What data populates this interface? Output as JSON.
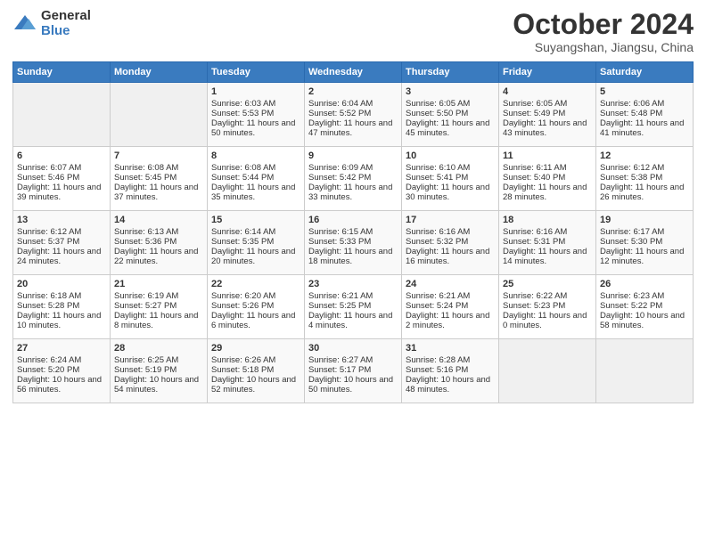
{
  "header": {
    "logo_general": "General",
    "logo_blue": "Blue",
    "month": "October 2024",
    "location": "Suyangshan, Jiangsu, China"
  },
  "weekdays": [
    "Sunday",
    "Monday",
    "Tuesday",
    "Wednesday",
    "Thursday",
    "Friday",
    "Saturday"
  ],
  "weeks": [
    [
      {
        "day": "",
        "empty": true
      },
      {
        "day": "",
        "empty": true
      },
      {
        "day": "1",
        "sunrise": "6:03 AM",
        "sunset": "5:53 PM",
        "daylight": "11 hours and 50 minutes."
      },
      {
        "day": "2",
        "sunrise": "6:04 AM",
        "sunset": "5:52 PM",
        "daylight": "11 hours and 47 minutes."
      },
      {
        "day": "3",
        "sunrise": "6:05 AM",
        "sunset": "5:50 PM",
        "daylight": "11 hours and 45 minutes."
      },
      {
        "day": "4",
        "sunrise": "6:05 AM",
        "sunset": "5:49 PM",
        "daylight": "11 hours and 43 minutes."
      },
      {
        "day": "5",
        "sunrise": "6:06 AM",
        "sunset": "5:48 PM",
        "daylight": "11 hours and 41 minutes."
      }
    ],
    [
      {
        "day": "6",
        "sunrise": "6:07 AM",
        "sunset": "5:46 PM",
        "daylight": "11 hours and 39 minutes."
      },
      {
        "day": "7",
        "sunrise": "6:08 AM",
        "sunset": "5:45 PM",
        "daylight": "11 hours and 37 minutes."
      },
      {
        "day": "8",
        "sunrise": "6:08 AM",
        "sunset": "5:44 PM",
        "daylight": "11 hours and 35 minutes."
      },
      {
        "day": "9",
        "sunrise": "6:09 AM",
        "sunset": "5:42 PM",
        "daylight": "11 hours and 33 minutes."
      },
      {
        "day": "10",
        "sunrise": "6:10 AM",
        "sunset": "5:41 PM",
        "daylight": "11 hours and 30 minutes."
      },
      {
        "day": "11",
        "sunrise": "6:11 AM",
        "sunset": "5:40 PM",
        "daylight": "11 hours and 28 minutes."
      },
      {
        "day": "12",
        "sunrise": "6:12 AM",
        "sunset": "5:38 PM",
        "daylight": "11 hours and 26 minutes."
      }
    ],
    [
      {
        "day": "13",
        "sunrise": "6:12 AM",
        "sunset": "5:37 PM",
        "daylight": "11 hours and 24 minutes."
      },
      {
        "day": "14",
        "sunrise": "6:13 AM",
        "sunset": "5:36 PM",
        "daylight": "11 hours and 22 minutes."
      },
      {
        "day": "15",
        "sunrise": "6:14 AM",
        "sunset": "5:35 PM",
        "daylight": "11 hours and 20 minutes."
      },
      {
        "day": "16",
        "sunrise": "6:15 AM",
        "sunset": "5:33 PM",
        "daylight": "11 hours and 18 minutes."
      },
      {
        "day": "17",
        "sunrise": "6:16 AM",
        "sunset": "5:32 PM",
        "daylight": "11 hours and 16 minutes."
      },
      {
        "day": "18",
        "sunrise": "6:16 AM",
        "sunset": "5:31 PM",
        "daylight": "11 hours and 14 minutes."
      },
      {
        "day": "19",
        "sunrise": "6:17 AM",
        "sunset": "5:30 PM",
        "daylight": "11 hours and 12 minutes."
      }
    ],
    [
      {
        "day": "20",
        "sunrise": "6:18 AM",
        "sunset": "5:28 PM",
        "daylight": "11 hours and 10 minutes."
      },
      {
        "day": "21",
        "sunrise": "6:19 AM",
        "sunset": "5:27 PM",
        "daylight": "11 hours and 8 minutes."
      },
      {
        "day": "22",
        "sunrise": "6:20 AM",
        "sunset": "5:26 PM",
        "daylight": "11 hours and 6 minutes."
      },
      {
        "day": "23",
        "sunrise": "6:21 AM",
        "sunset": "5:25 PM",
        "daylight": "11 hours and 4 minutes."
      },
      {
        "day": "24",
        "sunrise": "6:21 AM",
        "sunset": "5:24 PM",
        "daylight": "11 hours and 2 minutes."
      },
      {
        "day": "25",
        "sunrise": "6:22 AM",
        "sunset": "5:23 PM",
        "daylight": "11 hours and 0 minutes."
      },
      {
        "day": "26",
        "sunrise": "6:23 AM",
        "sunset": "5:22 PM",
        "daylight": "10 hours and 58 minutes."
      }
    ],
    [
      {
        "day": "27",
        "sunrise": "6:24 AM",
        "sunset": "5:20 PM",
        "daylight": "10 hours and 56 minutes."
      },
      {
        "day": "28",
        "sunrise": "6:25 AM",
        "sunset": "5:19 PM",
        "daylight": "10 hours and 54 minutes."
      },
      {
        "day": "29",
        "sunrise": "6:26 AM",
        "sunset": "5:18 PM",
        "daylight": "10 hours and 52 minutes."
      },
      {
        "day": "30",
        "sunrise": "6:27 AM",
        "sunset": "5:17 PM",
        "daylight": "10 hours and 50 minutes."
      },
      {
        "day": "31",
        "sunrise": "6:28 AM",
        "sunset": "5:16 PM",
        "daylight": "10 hours and 48 minutes."
      },
      {
        "day": "",
        "empty": true
      },
      {
        "day": "",
        "empty": true
      }
    ]
  ]
}
